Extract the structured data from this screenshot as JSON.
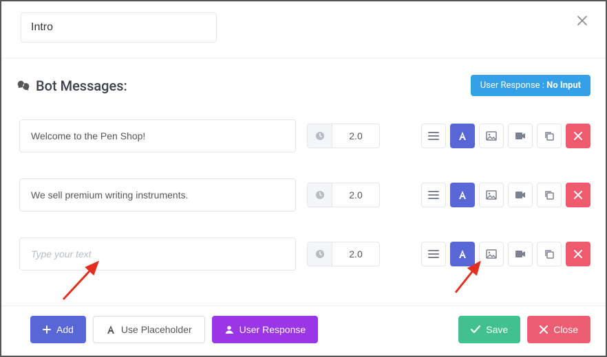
{
  "title_value": "Intro",
  "section_title": "Bot Messages:",
  "user_response_badge_label": "User Response :",
  "user_response_badge_value": "No Input",
  "messages": [
    {
      "text": "Welcome to the Pen Shop!",
      "delay": "2.0"
    },
    {
      "text": "We sell premium writing instruments.",
      "delay": "2.0"
    },
    {
      "text": "",
      "delay": "2.0"
    }
  ],
  "placeholder_text": "Type your text",
  "footer": {
    "add": "Add",
    "placeholder": "Use Placeholder",
    "user_response": "User Response",
    "save": "Save",
    "close": "Close"
  }
}
